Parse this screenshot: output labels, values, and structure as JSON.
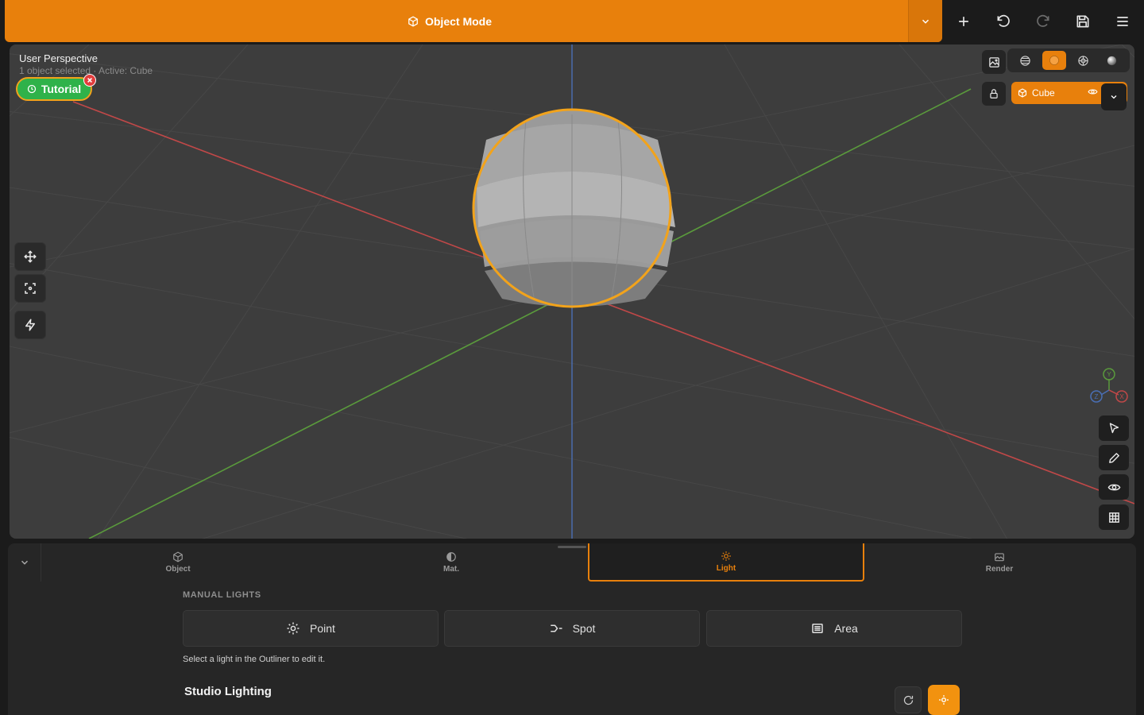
{
  "topbar": {
    "mode_label": "Object Mode",
    "mode_icon": "cube-icon",
    "actions": [
      "plus-icon",
      "undo-icon",
      "redo-icon",
      "save-icon",
      "menu-icon"
    ]
  },
  "viewport": {
    "title": "User Perspective",
    "subtitle": "1 object selected · Active: Cube",
    "tutorial_label": "Tutorial",
    "active_object": "Cube",
    "shading_modes": [
      "wireframe-icon",
      "solid-icon",
      "material-icon",
      "rendered-icon"
    ],
    "active_shading": "solid-icon",
    "gizmo_axes": [
      "Y",
      "Z",
      "X"
    ],
    "left_tools": [
      "move-icon",
      "focus-icon",
      "lightning-icon"
    ],
    "right_tools": [
      "select-cursor-icon",
      "pencil-icon",
      "eye-icon",
      "grid-icon"
    ]
  },
  "panel": {
    "tabs": [
      {
        "label": "Object",
        "icon": "cube-icon"
      },
      {
        "label": "Mat.",
        "icon": "half-circle-icon"
      },
      {
        "label": "Light",
        "icon": "sun-icon"
      },
      {
        "label": "Render",
        "icon": "render-icon"
      }
    ],
    "active_tab": "Light",
    "section_label": "MANUAL LIGHTS",
    "light_buttons": [
      {
        "label": "Point",
        "icon": "point-light-icon"
      },
      {
        "label": "Spot",
        "icon": "spot-light-icon"
      },
      {
        "label": "Area",
        "icon": "area-light-icon"
      }
    ],
    "hint": "Select a light in the Outliner to edit it.",
    "studio_title": "Studio Lighting"
  },
  "colors": {
    "accent": "#e8800c",
    "tutorial_green": "#2fb24a",
    "x_axis": "#c04848",
    "y_axis": "#5a9a3c",
    "z_axis": "#4a6fb5"
  }
}
